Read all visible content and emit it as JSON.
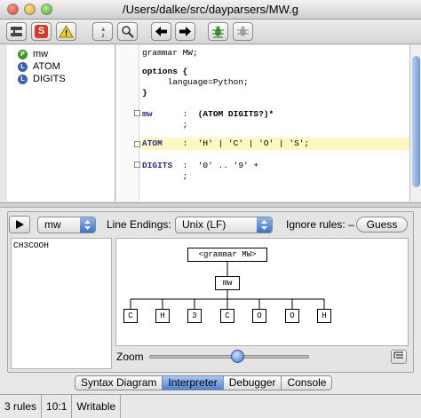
{
  "window": {
    "title": "/Users/dalke/src/dayparsers/MW.g"
  },
  "toolbar": {
    "buttons": [
      {
        "icon": "rules-icon"
      },
      {
        "icon": "syntax-check-icon",
        "label": "S"
      },
      {
        "icon": "warning-icon",
        "label": "!"
      },
      {
        "icon": "sort-icon",
        "label": "a z"
      },
      {
        "icon": "magnifier-icon"
      },
      {
        "icon": "back-arrow-icon"
      },
      {
        "icon": "forward-arrow-icon"
      },
      {
        "icon": "debug-bug-icon"
      },
      {
        "icon": "disabled-bug-icon"
      }
    ]
  },
  "rules": [
    {
      "badge": "P",
      "name": "mw"
    },
    {
      "badge": "L",
      "name": "ATOM"
    },
    {
      "badge": "L",
      "name": "DIGITS"
    }
  ],
  "editor": {
    "lines": {
      "l1": "grammar MW;",
      "l2a": "options",
      "l2b": " {",
      "l3": "     language=Python;",
      "l4": "}",
      "l5a": "mw",
      "l5b": "      :  ",
      "l5c": "(ATOM DIGITS?)*",
      "l6": "        ;",
      "l7a": "ATOM",
      "l7b": "    :  'H' | 'C' | 'O' | 'S';",
      "l8a": "DIGITS",
      "l8b": "  :  '0' .. '9' +",
      "l9": "        ;"
    }
  },
  "interpreter": {
    "rule_select": "mw",
    "line_endings_label": "Line Endings:",
    "line_endings_value": "Unix (LF)",
    "ignore_rules_label": "Ignore rules: –",
    "guess_label": "Guess",
    "input_text": "CH3COOH",
    "tree": {
      "root": "<grammar MW>",
      "child": "mw",
      "leaves": [
        "C",
        "H",
        "3",
        "C",
        "O",
        "O",
        "H"
      ]
    },
    "zoom_label": "Zoom",
    "zoom_fraction": 0.55
  },
  "tabs": [
    {
      "label": "Syntax Diagram",
      "active": false
    },
    {
      "label": "Interpreter",
      "active": true
    },
    {
      "label": "Debugger",
      "active": false
    },
    {
      "label": "Console",
      "active": false
    }
  ],
  "status": {
    "rules": "3 rules",
    "position": "10:1",
    "mode": "Writable"
  }
}
